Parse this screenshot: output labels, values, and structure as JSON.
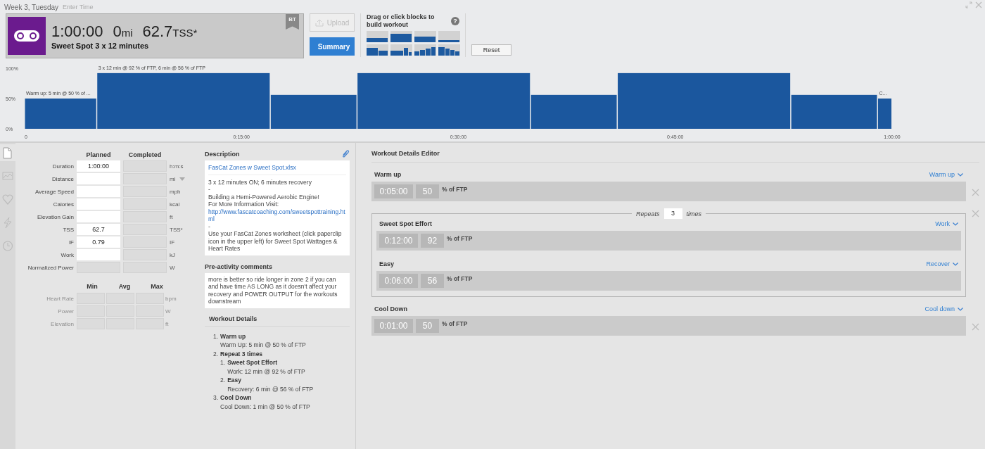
{
  "header": {
    "date": "Week 3, Tuesday",
    "time_placeholder": "Enter Time"
  },
  "workout": {
    "duration": "1:00:00",
    "distance": "0",
    "distance_unit": "mi",
    "tss": "62.7",
    "tss_unit": "TSS*",
    "title": "Sweet Spot 3 x 12 minutes",
    "badge": "BT"
  },
  "actions": [
    {
      "kind": "upload",
      "label": "Upload",
      "disabled": true,
      "selected": false
    },
    {
      "kind": "summary",
      "label": "Summary",
      "disabled": false,
      "selected": true
    }
  ],
  "builder": {
    "hint": "Drag or click blocks to build workout",
    "help": "?",
    "reset": "Reset"
  },
  "chart": {
    "chart_data": {
      "type": "bar",
      "x": [
        2.5,
        11,
        20,
        29,
        38,
        47,
        56,
        59.5
      ],
      "values": [
        50,
        92,
        56,
        92,
        56,
        92,
        56,
        50
      ],
      "xlim": [
        0,
        60
      ],
      "ylim": [
        0,
        100
      ],
      "xticks": [
        {
          "value": 0,
          "label": "0"
        },
        {
          "value": 15,
          "label": "0:15:00"
        },
        {
          "value": 30,
          "label": "0:30:00"
        },
        {
          "value": 45,
          "label": "0:45:00"
        },
        {
          "value": 60,
          "label": "1:00:00"
        }
      ],
      "yticks": [
        {
          "value": 0,
          "label": "0%"
        },
        {
          "value": 50,
          "label": "50%"
        },
        {
          "value": 100,
          "label": "100%"
        }
      ],
      "annotations": [
        {
          "text": "Warm up: 5 min @ 50 % of ...",
          "x": 2.5,
          "y": 50
        },
        {
          "text": "3 x 12 min @ 92 % of FTP, 6 min @ 56 % of FTP",
          "x": 11,
          "y": 92
        },
        {
          "text": "C...",
          "x": 59.5,
          "y": 50
        }
      ]
    }
  },
  "side_tabs": [
    {
      "kind": "document",
      "selected": true
    },
    {
      "kind": "chart",
      "selected": false
    },
    {
      "kind": "heart",
      "selected": false
    },
    {
      "kind": "bolt",
      "selected": false
    },
    {
      "kind": "clock",
      "selected": false
    }
  ],
  "form": {
    "columns": [
      "Planned",
      "Completed"
    ],
    "rows": [
      {
        "label": "Duration",
        "planned": "1:00:00",
        "unit": "h:m:s",
        "editable": true,
        "dropdown": false
      },
      {
        "label": "Distance",
        "unit": "mi",
        "editable": true,
        "dropdown": true
      },
      {
        "label": "Average Speed",
        "unit": "mph",
        "editable": true,
        "dropdown": false
      },
      {
        "label": "Calories",
        "unit": "kcal",
        "editable": true,
        "dropdown": false
      },
      {
        "label": "Elevation Gain",
        "unit": "ft",
        "editable": true,
        "dropdown": false
      },
      {
        "label": "TSS",
        "planned": "62.7",
        "unit": "TSS*",
        "editable": true,
        "dropdown": false
      },
      {
        "label": "IF",
        "planned": "0.79",
        "unit": "IF",
        "editable": true,
        "dropdown": false
      },
      {
        "label": "Work",
        "unit": "kJ",
        "editable": true,
        "dropdown": false
      },
      {
        "label": "Normalized Power",
        "unit": "W",
        "editable": false,
        "dropdown": false
      }
    ]
  },
  "ranges": {
    "columns": [
      "Min",
      "Avg",
      "Max"
    ],
    "disabled": true,
    "rows": [
      {
        "label": "Heart Rate",
        "unit": "bpm"
      },
      {
        "label": "Power",
        "unit": "W"
      },
      {
        "label": "Elevation",
        "unit": "ft"
      }
    ]
  },
  "description": {
    "title": "Description",
    "attachment": "FasCat Zones w Sweet Spot.xlsx",
    "paragraphs": [
      {
        "kind": "text",
        "text": "3 x 12 minutes ON; 6 minutes recovery"
      },
      {
        "kind": "text",
        "text": "-"
      },
      {
        "kind": "text",
        "text": "Building a Hemi-Powered Aerobic Engine!"
      },
      {
        "kind": "text",
        "text": "For More Information Visit:"
      },
      {
        "kind": "link",
        "text": "http://www.fascatcoaching.com/sweetspottraining.html"
      },
      {
        "kind": "text",
        "text": "-"
      },
      {
        "kind": "text",
        "text": "Use your FasCat Zones worksheet (click paperclip icon in the upper left) for Sweet Spot Wattages & Heart Rates"
      }
    ]
  },
  "comments": {
    "title": "Pre-activity comments",
    "text": "more is better so ride longer in zone 2 if you can and have time AS LONG as it doesn't affect your recovery and POWER OUTPUT for the workouts downstream"
  },
  "details": {
    "title": "Workout Details",
    "steps": [
      {
        "number": "1.",
        "title": "Warm up",
        "text": "Warm Up: 5 min @ 50 % of FTP"
      },
      {
        "number": "2.",
        "title": "Repeat 3 times",
        "children": [
          {
            "number": "1.",
            "title": "Sweet Spot Effort",
            "text": "Work: 12 min @ 92 % of FTP"
          },
          {
            "number": "2.",
            "title": "Easy",
            "text": "Recovery: 6 min @ 56 % of FTP"
          }
        ]
      },
      {
        "number": "3.",
        "title": "Cool Down",
        "text": "Cool Down: 1 min @ 50 % of FTP"
      }
    ]
  },
  "editor": {
    "title": "Workout Details Editor",
    "steps": [
      {
        "kind": "step",
        "name": "Warm up",
        "duration": "0:05:00",
        "intensity": "50",
        "unit": "% of FTP",
        "type": "Warm up"
      },
      {
        "kind": "repeat",
        "label": "Repeats",
        "count": "3",
        "suffix": "times",
        "children": [
          {
            "kind": "step",
            "name": "Sweet Spot Effort",
            "duration": "0:12:00",
            "intensity": "92",
            "unit": "% of FTP",
            "type": "Work"
          },
          {
            "kind": "step",
            "name": "Easy",
            "duration": "0:06:00",
            "intensity": "56",
            "unit": "% of FTP",
            "type": "Recover"
          }
        ]
      },
      {
        "kind": "step",
        "name": "Cool Down",
        "duration": "0:01:00",
        "intensity": "50",
        "unit": "% of FTP",
        "type": "Cool down"
      }
    ]
  }
}
